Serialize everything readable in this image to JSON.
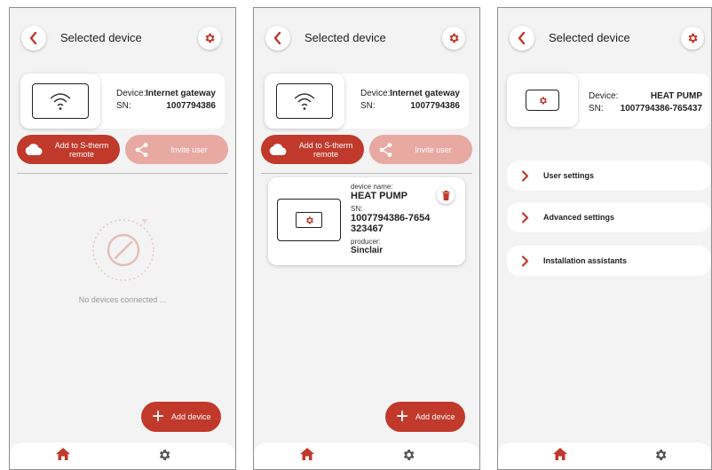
{
  "colors": {
    "accent": "#c0392b",
    "accent_faded": "#e8a9a3",
    "background": "#f3f3f3"
  },
  "header": {
    "title": "Selected device"
  },
  "gateway": {
    "device_label": "Device:",
    "device_value": "Internet gateway",
    "sn_label": "SN:",
    "sn_value": "1007794386"
  },
  "actions": {
    "add_remote": "Add to S-therm remote",
    "invite": "Invite user"
  },
  "empty": {
    "text": "No devices connected ..."
  },
  "add_device": {
    "label": "Add device"
  },
  "child_device": {
    "name_label": "device name:",
    "name": "HEAT PUMP",
    "sn_label": "SN:",
    "sn_line1": "1007794386-7654",
    "sn_line2": "323467",
    "producer_label": "producer:",
    "producer": "Sinclair"
  },
  "heat_pump": {
    "device_label": "Device:",
    "device_value": "HEAT PUMP",
    "sn_label": "SN:",
    "sn_value": "1007794386-765437"
  },
  "menu": [
    "User settings",
    "Advanced settings",
    "Installation assistants"
  ],
  "icons": {
    "back": "chevron-left-icon",
    "settings": "gear-icon",
    "wifi": "wifi-icon",
    "cloud": "cloud-icon",
    "share": "share-icon",
    "trash": "trash-icon",
    "home": "home-icon",
    "chevron": "chevron-right-icon"
  }
}
